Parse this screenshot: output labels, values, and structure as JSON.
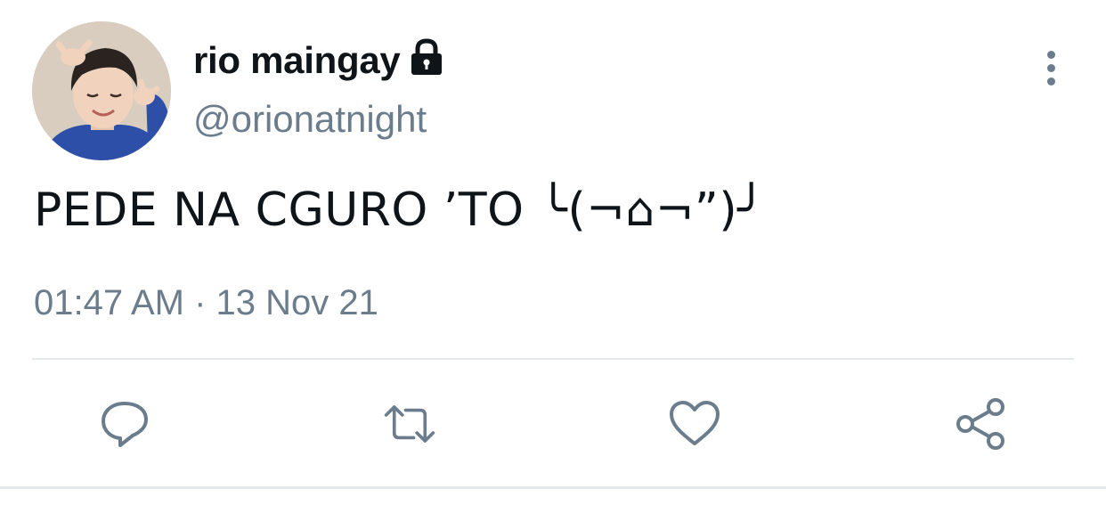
{
  "tweet": {
    "display_name": "rio maingay",
    "handle": "@orionatnight",
    "text": "PEDE NA CGURO ’TO ╰(¬⌂¬”)╯",
    "timestamp": "01:47 AM · 13 Nov 21"
  },
  "icons": {
    "avatar": "avatar",
    "lock": "lock-icon",
    "more": "more-icon",
    "reply": "reply-icon",
    "retweet": "retweet-icon",
    "like": "heart-icon",
    "share": "share-icon"
  },
  "colors": {
    "text_primary": "#0f1419",
    "text_secondary": "#6b7d8c",
    "icon": "#6b7d8c",
    "divider": "#e6eaed"
  }
}
